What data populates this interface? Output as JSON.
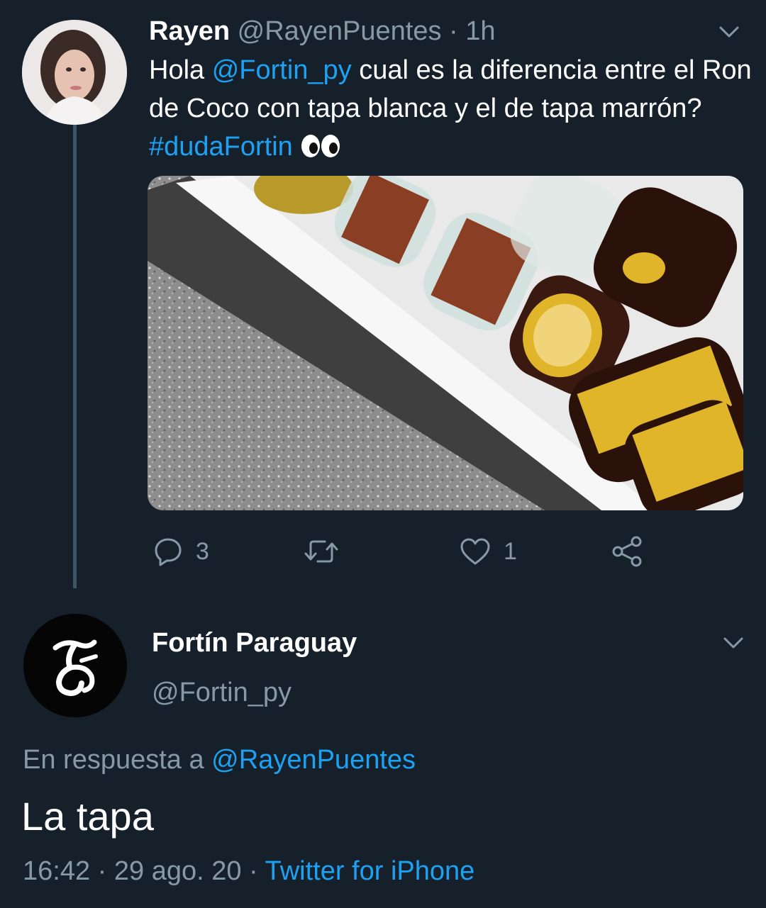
{
  "tweet": {
    "author_name": "Rayen",
    "author_handle": "@RayenPuentes",
    "separator": "·",
    "time": "1h",
    "text_before_mention": "Hola ",
    "mention": "@Fortin_py",
    "text_line": " cual es la diferencia entre el Ron de Coco con tapa blanca y el de tapa marrón? ",
    "hashtag": "#dudaFortin",
    "emoji": "eyes-emoji",
    "photo_description_icon": "photo",
    "actions": {
      "reply_count": "3",
      "retweet_count": "",
      "like_count": "1"
    }
  },
  "reply": {
    "author_name": "Fortín Paraguay",
    "author_handle": "@Fortin_py",
    "reply_prefix": "En respuesta a ",
    "reply_to_handle": "@RayenPuentes",
    "text": "La tapa",
    "time": "16:42",
    "separator": "·",
    "date": "29 ago. 20",
    "source": "Twitter for iPhone"
  },
  "colors": {
    "background": "#15202b",
    "secondary_text": "#8899a6",
    "link": "#1da1f2"
  }
}
